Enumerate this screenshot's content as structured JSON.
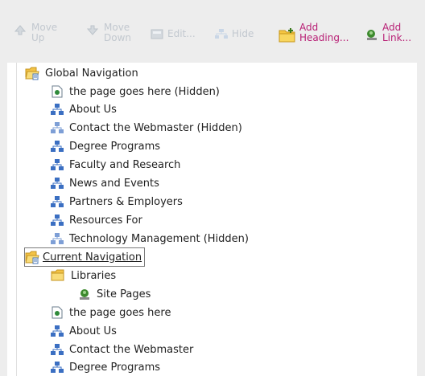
{
  "toolbar": {
    "move_up": "Move Up",
    "move_down": "Move Down",
    "edit": "Edit...",
    "hide": "Hide",
    "add_heading": "Add Heading...",
    "add_link": "Add Link..."
  },
  "tree": {
    "global_navigation": "Global Navigation",
    "global_items": [
      "the page goes here (Hidden)",
      "About Us",
      "Contact the Webmaster (Hidden)",
      "Degree Programs",
      "Faculty and Research",
      "News and Events",
      "Partners & Employers",
      "Resources For",
      "Technology Management (Hidden)"
    ],
    "current_navigation": "Current Navigation",
    "libraries": "Libraries",
    "site_pages": "Site Pages",
    "current_items": [
      "the page goes here",
      "About Us",
      "Contact the Webmaster",
      "Degree Programs"
    ]
  },
  "colors": {
    "link_accent": "#b81f75",
    "disabled_text": "#c2c8cf",
    "toolbar_bg": "#ededed"
  }
}
